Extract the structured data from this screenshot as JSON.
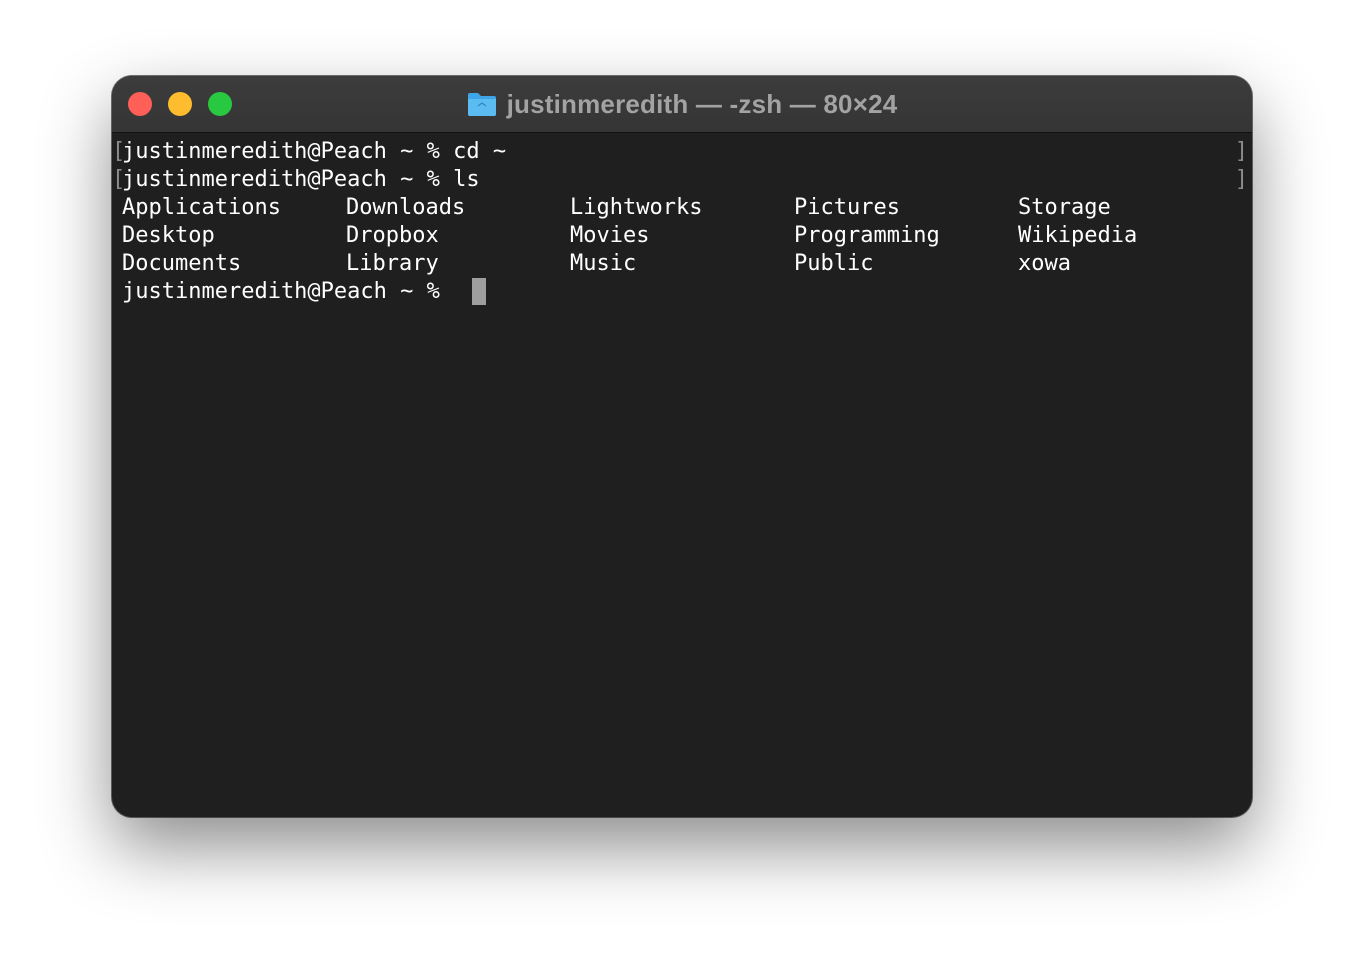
{
  "window": {
    "title": "justinmeredith — -zsh — 80×24",
    "buttons": {
      "close": "close",
      "minimize": "minimize",
      "zoom": "zoom"
    },
    "colors": {
      "close": "#fe5f57",
      "minimize": "#febc2e",
      "zoom": "#28c840",
      "folder": "#3ea6e8"
    }
  },
  "terminal": {
    "lines": [
      {
        "prompt": "justinmeredith@Peach ~ %",
        "command": "cd ~",
        "marked": true
      },
      {
        "prompt": "justinmeredith@Peach ~ %",
        "command": "ls",
        "marked": true
      }
    ],
    "ls_output": [
      [
        "Applications",
        "Downloads",
        "Lightworks",
        "Pictures",
        "Storage"
      ],
      [
        "Desktop",
        "Dropbox",
        "Movies",
        "Programming",
        "Wikipedia"
      ],
      [
        "Documents",
        "Library",
        "Music",
        "Public",
        "xowa"
      ]
    ],
    "current_prompt": "justinmeredith@Peach ~ %"
  }
}
